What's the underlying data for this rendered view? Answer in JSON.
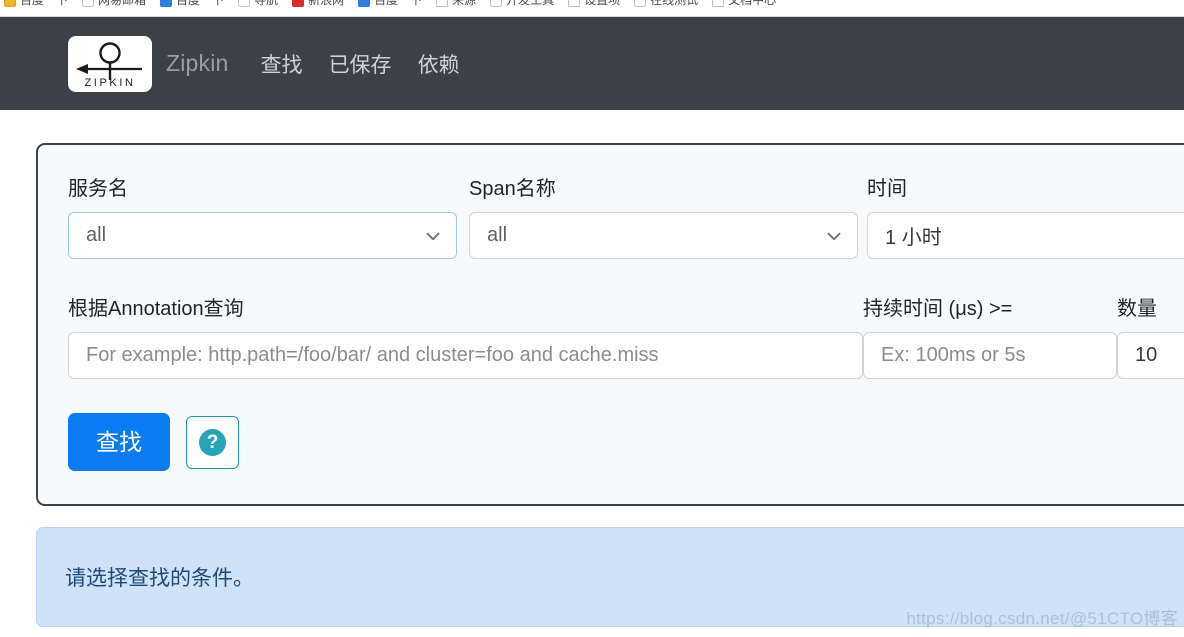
{
  "browser": {
    "bookmarks": [
      {
        "label": "百度一下",
        "icon": "bookmark-favicon",
        "color": "gold"
      },
      {
        "label": "网易邮箱",
        "icon": "bookmark-favicon",
        "color": "white"
      },
      {
        "label": "百度一下",
        "icon": "bookmark-favicon",
        "color": "blue"
      },
      {
        "label": "导航",
        "icon": "bookmark-favicon",
        "color": "white"
      },
      {
        "label": "新浪网",
        "icon": "bookmark-favicon",
        "color": "red"
      },
      {
        "label": "百度一下",
        "icon": "bookmark-favicon",
        "color": "blue"
      },
      {
        "label": "来源",
        "icon": "bookmark-favicon",
        "color": "white"
      },
      {
        "label": "开发工具",
        "icon": "bookmark-favicon",
        "color": "white"
      },
      {
        "label": "设置项",
        "icon": "bookmark-favicon",
        "color": "white"
      },
      {
        "label": "在线测试",
        "icon": "bookmark-favicon",
        "color": "white"
      },
      {
        "label": "文档中心",
        "icon": "bookmark-favicon",
        "color": "white"
      }
    ]
  },
  "navbar": {
    "logo_word": "ZIPKIN",
    "brand": "Zipkin",
    "links": [
      {
        "label": "查找",
        "name": "nav-link-search"
      },
      {
        "label": "已保存",
        "name": "nav-link-saved"
      },
      {
        "label": "依赖",
        "name": "nav-link-dependencies"
      }
    ]
  },
  "search_form": {
    "service": {
      "label": "服务名",
      "value": "all",
      "icon": "chevron-down-icon"
    },
    "span": {
      "label": "Span名称",
      "value": "all",
      "icon": "chevron-down-icon"
    },
    "time": {
      "label": "时间",
      "value": "1 小时"
    },
    "annotation": {
      "label": "根据Annotation查询",
      "placeholder": "For example: http.path=/foo/bar/ and cluster=foo and cache.miss",
      "value": ""
    },
    "duration": {
      "label": "持续时间 (μs) >=",
      "placeholder": "Ex: 100ms or 5s",
      "value": ""
    },
    "limit": {
      "label": "数量",
      "value": "10"
    },
    "search_button": "查找",
    "help_button": "?"
  },
  "alert": {
    "message": "请选择查找的条件。"
  },
  "watermark": {
    "text": "https://blog.csdn.net/@51CTO博客"
  },
  "colors": {
    "navbar_bg": "#3c4049",
    "primary_button": "#0b7bf2",
    "help_accent": "#28a4b8",
    "alert_bg": "#cfe2f7",
    "alert_text": "#1b4a78",
    "card_bg": "#f8f9fa",
    "card_border": "#3d4149",
    "focus_border": "#9ec5e8"
  }
}
